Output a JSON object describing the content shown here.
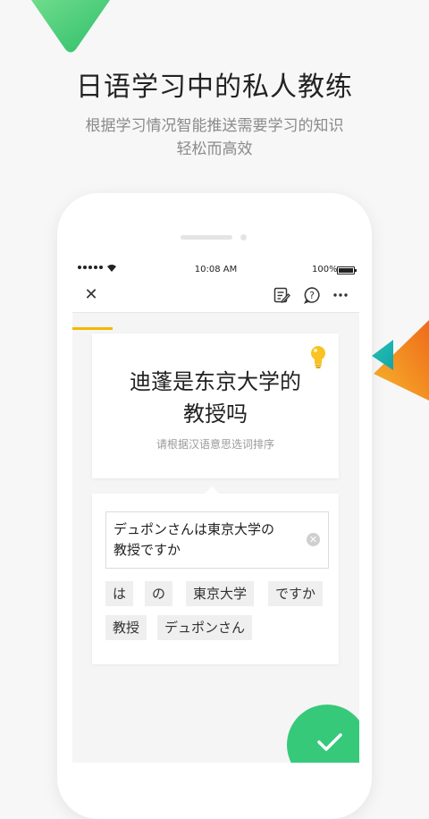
{
  "header": {
    "title": "日语学习中的私人教练",
    "subtitle_lines": [
      "根据学习情况智能推送需要学习的知识",
      "轻松而高效"
    ]
  },
  "status_bar": {
    "time": "10:08 AM",
    "battery": "100%"
  },
  "toolbar": {
    "icons": [
      "close-icon",
      "notes-icon",
      "help-icon",
      "more-icon"
    ],
    "progress_fraction": 0.14
  },
  "question": {
    "lines": [
      "迪蓬是东京大学的",
      "教授吗"
    ],
    "hint": "请根据汉语意思选词排序"
  },
  "answer": {
    "lines": [
      "デュポンさんは東京大学の",
      "教授ですか"
    ],
    "chips": [
      "は",
      "の",
      "東京大学",
      "ですか",
      "教授",
      "デュポンさん"
    ]
  },
  "colors": {
    "accent_green": "#37c97a",
    "accent_yellow": "#f5b800",
    "triangle_orange": "#f08a1f",
    "triangle_teal": "#19b7b0"
  }
}
